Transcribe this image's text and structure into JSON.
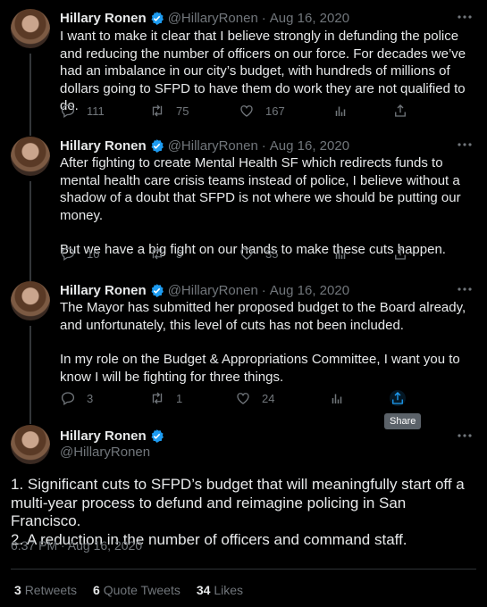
{
  "author": {
    "name": "Hillary Ronen",
    "handle": "@HillaryRonen",
    "separator": "·",
    "verified": true
  },
  "tweets": [
    {
      "date": "Aug 16, 2020",
      "paragraphs": [
        "I want to make it clear that I believe strongly in defunding the police and reducing the number of officers on our force. For decades we’ve had an imbalance in our city’s budget, with hundreds of millions of dollars going to SFPD to have them do work they are not qualified to do."
      ],
      "replies": "111",
      "retweets": "75",
      "likes": "167"
    },
    {
      "date": "Aug 16, 2020",
      "paragraphs": [
        "After fighting to create Mental Health SF which redirects funds to mental health care crisis teams instead of police, I believe without a shadow of a doubt that SFPD is not where we should be putting our money.",
        "But we have a big fight on our hands to make these cuts happen."
      ],
      "replies": "10",
      "retweets": "5",
      "likes": "35"
    },
    {
      "date": "Aug 16, 2020",
      "paragraphs": [
        "The Mayor has submitted her proposed budget to the Board already, and unfortunately, this level of cuts has not been included.",
        "In my role on the Budget & Appropriations Committee, I want you to know I will be fighting for three things."
      ],
      "replies": "3",
      "retweets": "1",
      "likes": "24"
    }
  ],
  "share_tooltip": "Share",
  "main_tweet": {
    "lines": [
      "1. Significant cuts to SFPD’s budget that will meaningfully start off a multi-year process to defund and reimagine policing in San Francisco.",
      "2. A reduction in the number of officers and command staff."
    ],
    "timestamp": "6:37 PM · Aug 16, 2020",
    "stats": [
      {
        "count": "3",
        "label": "Retweets"
      },
      {
        "count": "6",
        "label": "Quote Tweets"
      },
      {
        "count": "34",
        "label": "Likes"
      }
    ]
  },
  "colors": {
    "background": "#000000",
    "text": "#e7e9ea",
    "muted": "#71767b",
    "verified": "#1d9bf0",
    "share_highlight": "#1d9bf0"
  }
}
